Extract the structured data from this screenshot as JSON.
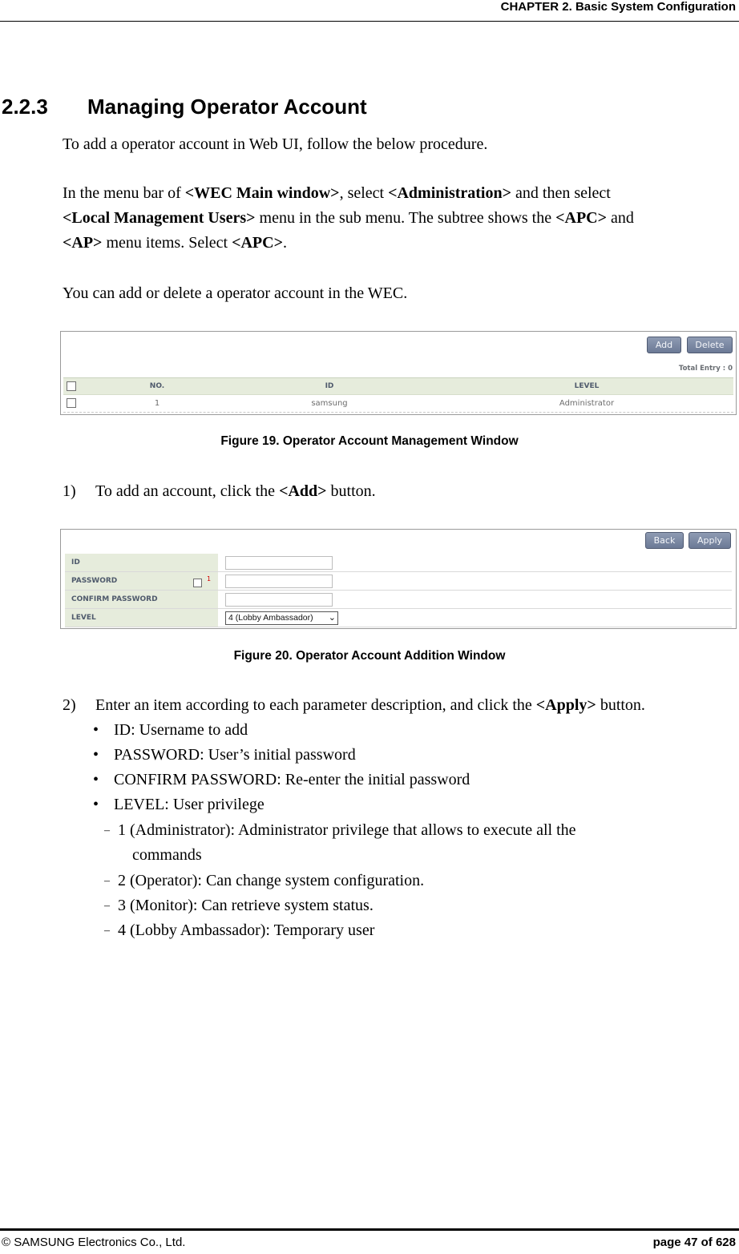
{
  "header": {
    "chapter": "CHAPTER 2. Basic System Configuration"
  },
  "section": {
    "number": "2.2.3",
    "title": "Managing Operator Account"
  },
  "intro": "To add a operator account in Web UI, follow the below procedure.",
  "nav_paragraph": {
    "t1": "In the menu bar of ",
    "b1": "<WEC Main window>",
    "t2": ", select ",
    "b2": "<Administration>",
    "t3": " and then select ",
    "b3": "<Local Management Users>",
    "t4": " menu in the sub menu. The subtree shows the ",
    "b4": "<APC>",
    "t5": " and ",
    "b5": "<AP>",
    "t6": " menu items. Select ",
    "b6": "<APC>",
    "t7": "."
  },
  "add_delete_text": "You can add or delete a operator account in the WEC.",
  "figure19": {
    "buttons": {
      "add": "Add",
      "delete": "Delete"
    },
    "total_entry": "Total Entry : 0",
    "columns": [
      "NO.",
      "ID",
      "LEVEL"
    ],
    "rows": [
      {
        "no": "1",
        "id": "samsung",
        "level": "Administrator"
      }
    ],
    "caption": "Figure 19. Operator Account Management Window"
  },
  "step1": {
    "num": "1)",
    "t1": "To add an account, click the ",
    "b1": "<Add>",
    "t2": " button."
  },
  "figure20": {
    "buttons": {
      "back": "Back",
      "apply": "Apply"
    },
    "fields": {
      "id_label": "ID",
      "password_label": "PASSWORD",
      "password_mark": "1",
      "confirm_label": "CONFIRM PASSWORD",
      "level_label": "LEVEL",
      "id_value": "",
      "password_value": "",
      "confirm_value": "",
      "level_value": "4 (Lobby Ambassador)"
    },
    "caption": "Figure 20. Operator Account Addition Window"
  },
  "step2": {
    "num": "2)",
    "t1": "Enter an item according to each parameter description, and click the ",
    "b1": "<Apply>",
    "t2": " button.",
    "bullets": [
      "ID: Username to add",
      "PASSWORD: User’s initial password",
      "CONFIRM PASSWORD: Re-enter the initial password",
      "LEVEL: User privilege"
    ],
    "levels": [
      {
        "first": "1 (Administrator): Administrator privilege that allows to execute all the",
        "cont": "commands"
      },
      {
        "first": "2 (Operator): Can change system configuration."
      },
      {
        "first": "3 (Monitor): Can retrieve system status."
      },
      {
        "first": "4 (Lobby Ambassador): Temporary user"
      }
    ]
  },
  "footer": {
    "copyright": "© SAMSUNG Electronics Co., Ltd.",
    "page": "page 47 of 628"
  }
}
